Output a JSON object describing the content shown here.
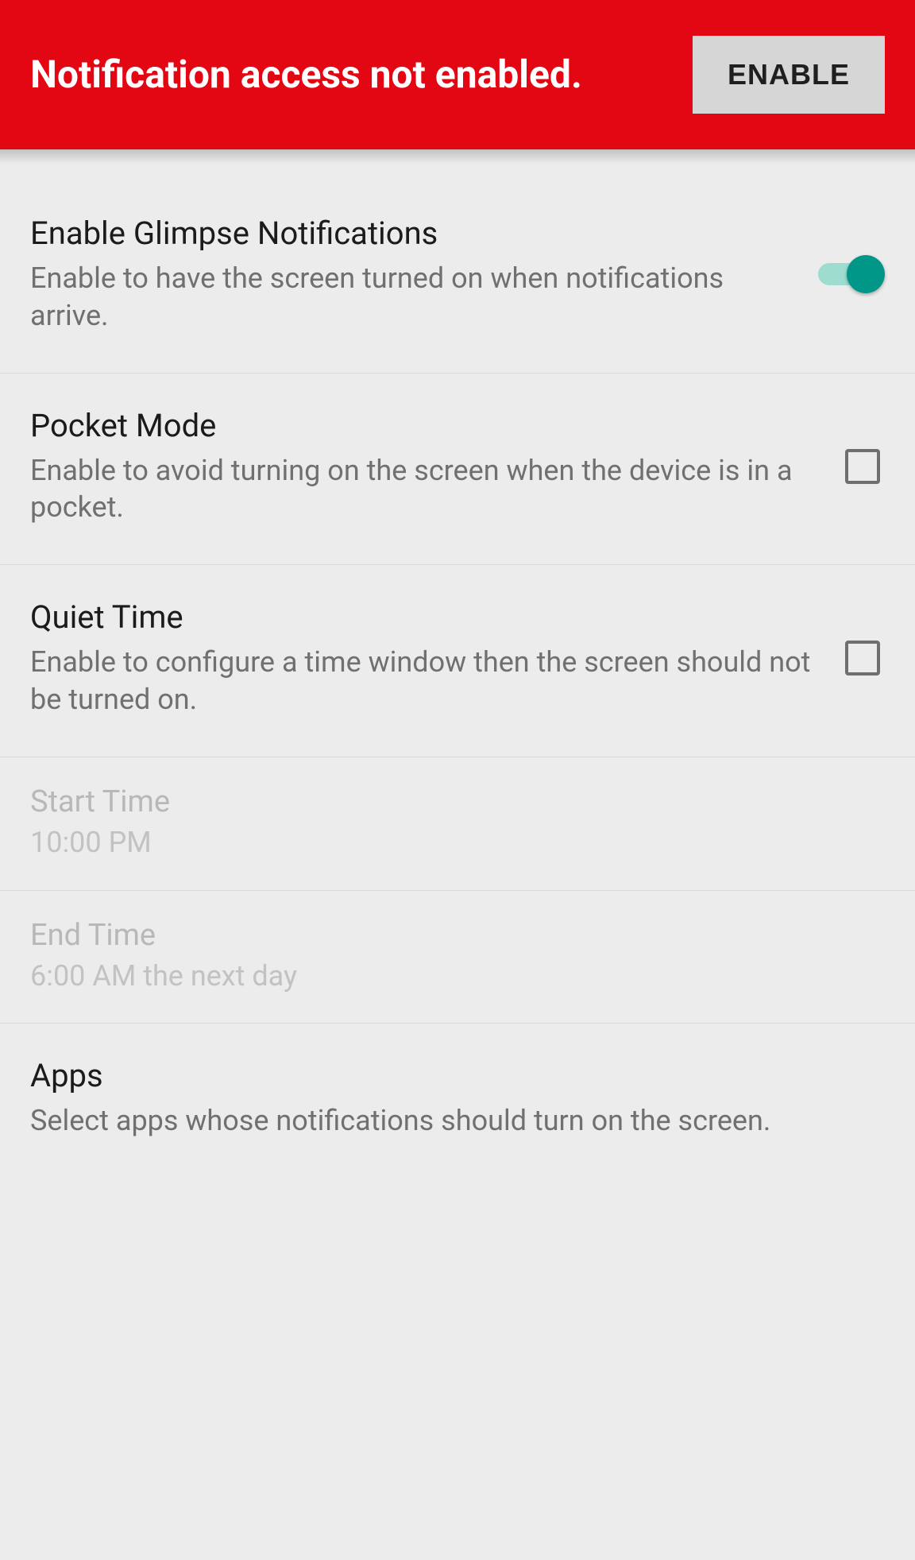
{
  "banner": {
    "message": "Notification access not enabled.",
    "button_label": "ENABLE"
  },
  "settings": {
    "glimpse": {
      "title": "Enable Glimpse Notifications",
      "desc": "Enable to have the screen turned on when notifications arrive.",
      "enabled": true
    },
    "pocket_mode": {
      "title": "Pocket Mode",
      "desc": "Enable to avoid turning on the screen when the device is in a pocket.",
      "checked": false
    },
    "quiet_time": {
      "title": "Quiet Time",
      "desc": "Enable to configure a time window then the screen should not be turned on.",
      "checked": false
    },
    "start_time": {
      "title": "Start Time",
      "value": "10:00 PM"
    },
    "end_time": {
      "title": "End Time",
      "value": "6:00 AM the next day"
    },
    "apps": {
      "title": "Apps",
      "desc": "Select apps whose notifications should turn on the screen."
    }
  }
}
